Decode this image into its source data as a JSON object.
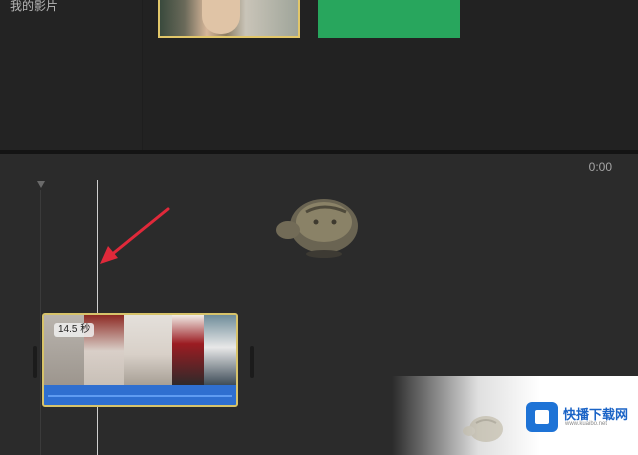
{
  "library": {
    "label": "我的影片"
  },
  "timeline": {
    "time_readout": "0:00",
    "clip": {
      "duration_badge": "14.5 秒"
    }
  },
  "watermark": {
    "name": "快播下载网",
    "url": "www.kuaibo.net"
  },
  "colors": {
    "clip_border": "#d7c36a",
    "audio_track": "#2f6fd0",
    "arrow": "#e0293a",
    "green_clip": "#28a65d",
    "logo_blue": "#1e73d6"
  }
}
